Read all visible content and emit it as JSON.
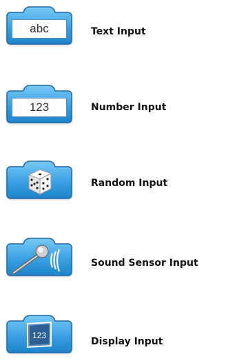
{
  "colors": {
    "block_top": "#6fc2f2",
    "block_bottom": "#1f86cf",
    "block_border": "#1a6aa8"
  },
  "blocks": [
    {
      "id": "text",
      "label": "Text Input",
      "field_value": "abc"
    },
    {
      "id": "number",
      "label": "Number Input",
      "field_value": "123"
    },
    {
      "id": "random",
      "label": "Random Input",
      "icon": "dice-icon"
    },
    {
      "id": "sound",
      "label": "Sound Sensor Input",
      "icon": "microphone-icon"
    },
    {
      "id": "display",
      "label": "Display Input",
      "icon": "display-icon",
      "icon_text": "123"
    }
  ]
}
